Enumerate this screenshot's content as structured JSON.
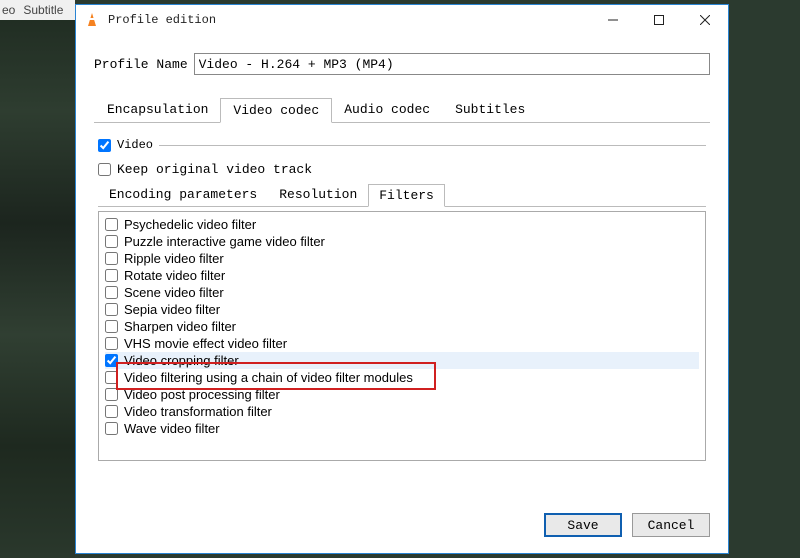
{
  "background_menu": {
    "item1": "eo",
    "item2": "Subtitle"
  },
  "window": {
    "title": "Profile edition",
    "minimize": "—",
    "maximize": "□",
    "close": "✕"
  },
  "profile": {
    "label": "Profile Name",
    "value": "Video - H.264 + MP3 (MP4)"
  },
  "outer_tabs": {
    "t0": "Encapsulation",
    "t1": "Video codec",
    "t2": "Audio codec",
    "t3": "Subtitles",
    "active": "t1"
  },
  "video_checks": {
    "video": {
      "label": "Video",
      "checked": true
    },
    "keep": {
      "label": "Keep original video track",
      "checked": false
    }
  },
  "inner_tabs": {
    "t0": "Encoding parameters",
    "t1": "Resolution",
    "t2": "Filters",
    "active": "t2"
  },
  "filters": [
    {
      "label": "Psychedelic video filter",
      "checked": false
    },
    {
      "label": "Puzzle interactive game video filter",
      "checked": false
    },
    {
      "label": "Ripple video filter",
      "checked": false
    },
    {
      "label": "Rotate video filter",
      "checked": false
    },
    {
      "label": "Scene video filter",
      "checked": false
    },
    {
      "label": "Sepia video filter",
      "checked": false
    },
    {
      "label": "Sharpen video filter",
      "checked": false
    },
    {
      "label": "VHS movie effect video filter",
      "checked": false
    },
    {
      "label": "Video cropping filter",
      "checked": true,
      "selected": true
    },
    {
      "label": "Video filtering using a chain of video filter modules",
      "checked": false
    },
    {
      "label": "Video post processing filter",
      "checked": false
    },
    {
      "label": "Video transformation filter",
      "checked": false
    },
    {
      "label": "Wave video filter",
      "checked": false
    }
  ],
  "footer": {
    "save": "Save",
    "cancel": "Cancel"
  },
  "colors": {
    "highlight": "#d02020",
    "dialog_border": "#2a84d2",
    "selected_row": "#e8f1fb"
  }
}
